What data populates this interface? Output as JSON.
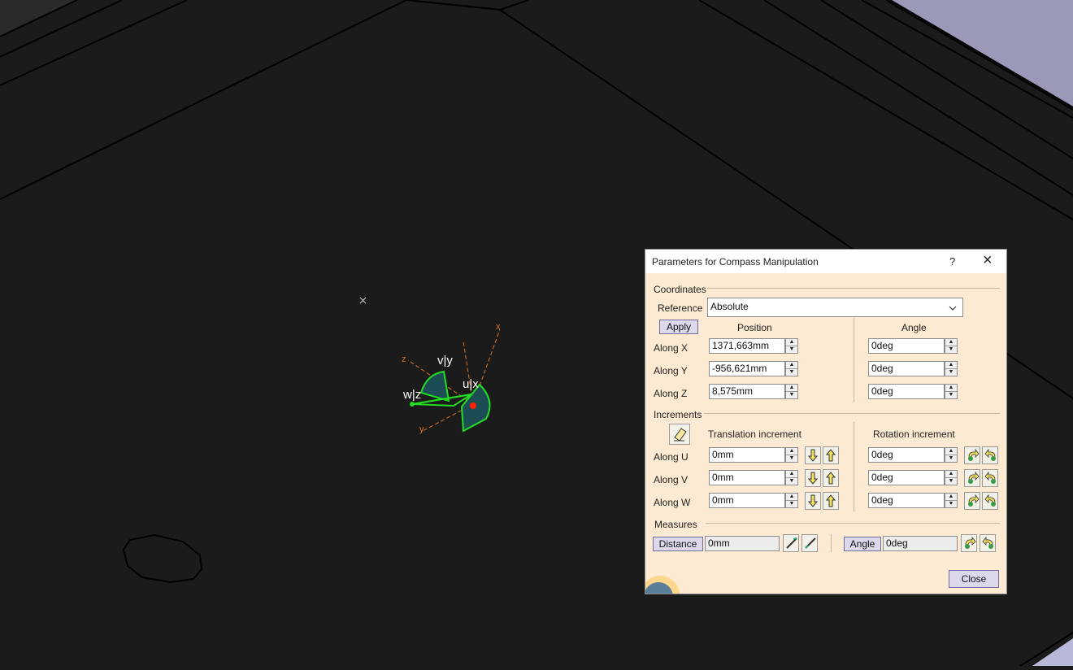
{
  "dialog": {
    "title": "Parameters for Compass Manipulation",
    "help_label": "?",
    "close_glyph": "×",
    "coordinates": {
      "group_label": "Coordinates",
      "reference_label": "Reference",
      "reference_value": "Absolute",
      "apply_label": "Apply",
      "position_header": "Position",
      "angle_header": "Angle",
      "rows": [
        {
          "label": "Along X",
          "position": "1371,663mm",
          "angle": "0deg"
        },
        {
          "label": "Along Y",
          "position": "-956,621mm",
          "angle": "0deg"
        },
        {
          "label": "Along Z",
          "position": "8,575mm",
          "angle": "0deg"
        }
      ]
    },
    "increments": {
      "group_label": "Increments",
      "translation_header": "Translation increment",
      "rotation_header": "Rotation increment",
      "rows": [
        {
          "label": "Along U",
          "translation": "0mm",
          "rotation": "0deg"
        },
        {
          "label": "Along V",
          "translation": "0mm",
          "rotation": "0deg"
        },
        {
          "label": "Along W",
          "translation": "0mm",
          "rotation": "0deg"
        }
      ]
    },
    "measures": {
      "group_label": "Measures",
      "distance_label": "Distance",
      "distance_value": "0mm",
      "angle_label": "Angle",
      "angle_value": "0deg"
    },
    "close_label": "Close"
  },
  "viewport": {
    "compass_labels": {
      "v": "v|y",
      "u": "u|x",
      "w": "w|z"
    },
    "axis_labels": {
      "x": "x",
      "y": "y",
      "z": "z"
    }
  },
  "colors": {
    "background": "#1b1b1b",
    "dialog_bg": "#fcebd2",
    "compass_green": "#22dd22",
    "compass_fill": "#1c4d55",
    "axis_orange": "#e07020",
    "origin_red": "#ff2200"
  },
  "icons": [
    "eraser-icon",
    "arrow-down-icon",
    "arrow-up-icon",
    "rotate-left-icon",
    "rotate-right-icon",
    "measure-pen-icon",
    "chevron-down-icon",
    "spin-arrows-icon",
    "catia-logo-icon"
  ]
}
